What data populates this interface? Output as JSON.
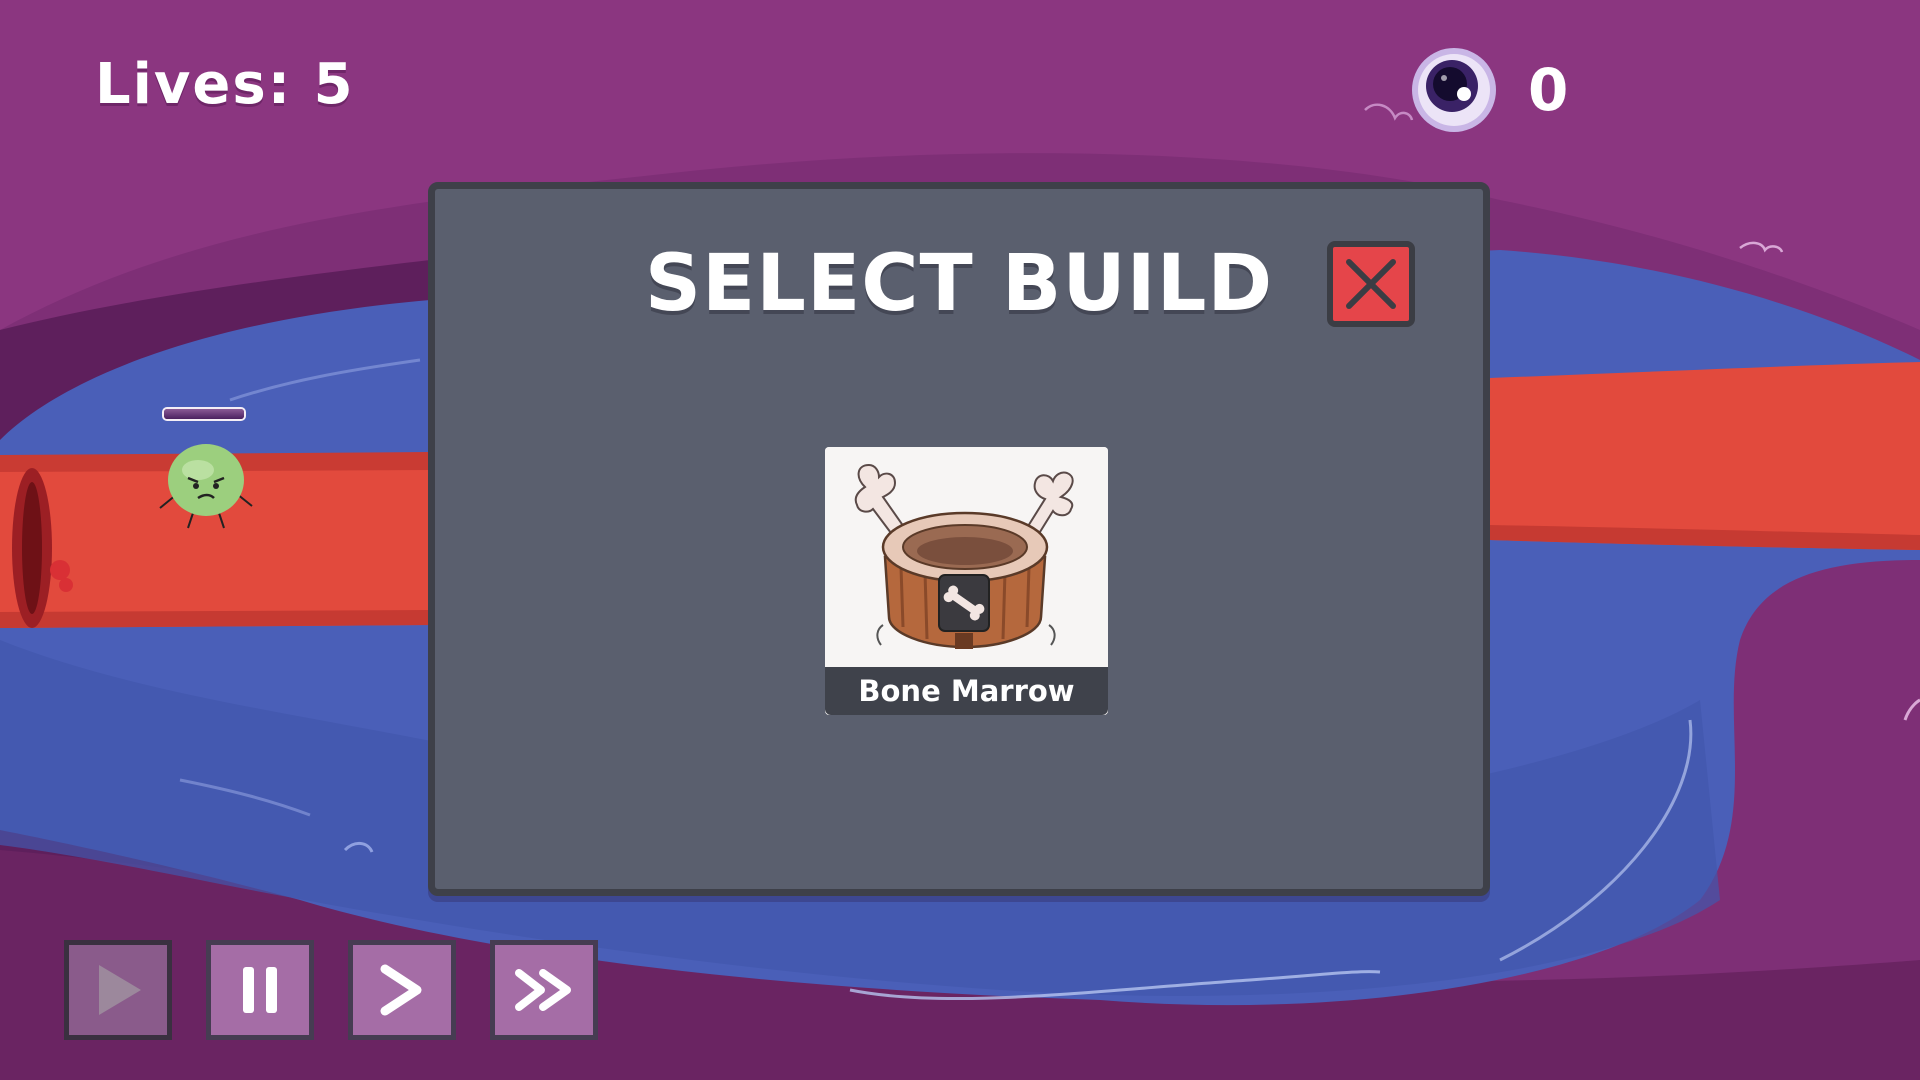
{
  "hud": {
    "lives_label": "Lives: 5",
    "currency_icon": "eye-icon",
    "currency_value": "0"
  },
  "modal": {
    "title": "SELECT BUILD",
    "close_icon": "close-icon",
    "builds": [
      {
        "name": "Bone Marrow",
        "icon": "bone-marrow-tower-icon"
      }
    ]
  },
  "controls": [
    {
      "name": "play",
      "icon": "play-icon"
    },
    {
      "name": "pause",
      "icon": "pause-icon"
    },
    {
      "name": "speed-normal",
      "icon": "chevron-right-icon"
    },
    {
      "name": "speed-fast",
      "icon": "double-chevron-right-icon"
    }
  ],
  "enemy": {
    "health_fraction": 1.0
  },
  "colors": {
    "background_purple": "#7e2f76",
    "blood_vessel_blue": "#4a5fb8",
    "artery_red": "#e24a3d",
    "modal_bg": "#5a5f6e",
    "close_red": "#e5454a",
    "button_purple": "#a56da6"
  }
}
